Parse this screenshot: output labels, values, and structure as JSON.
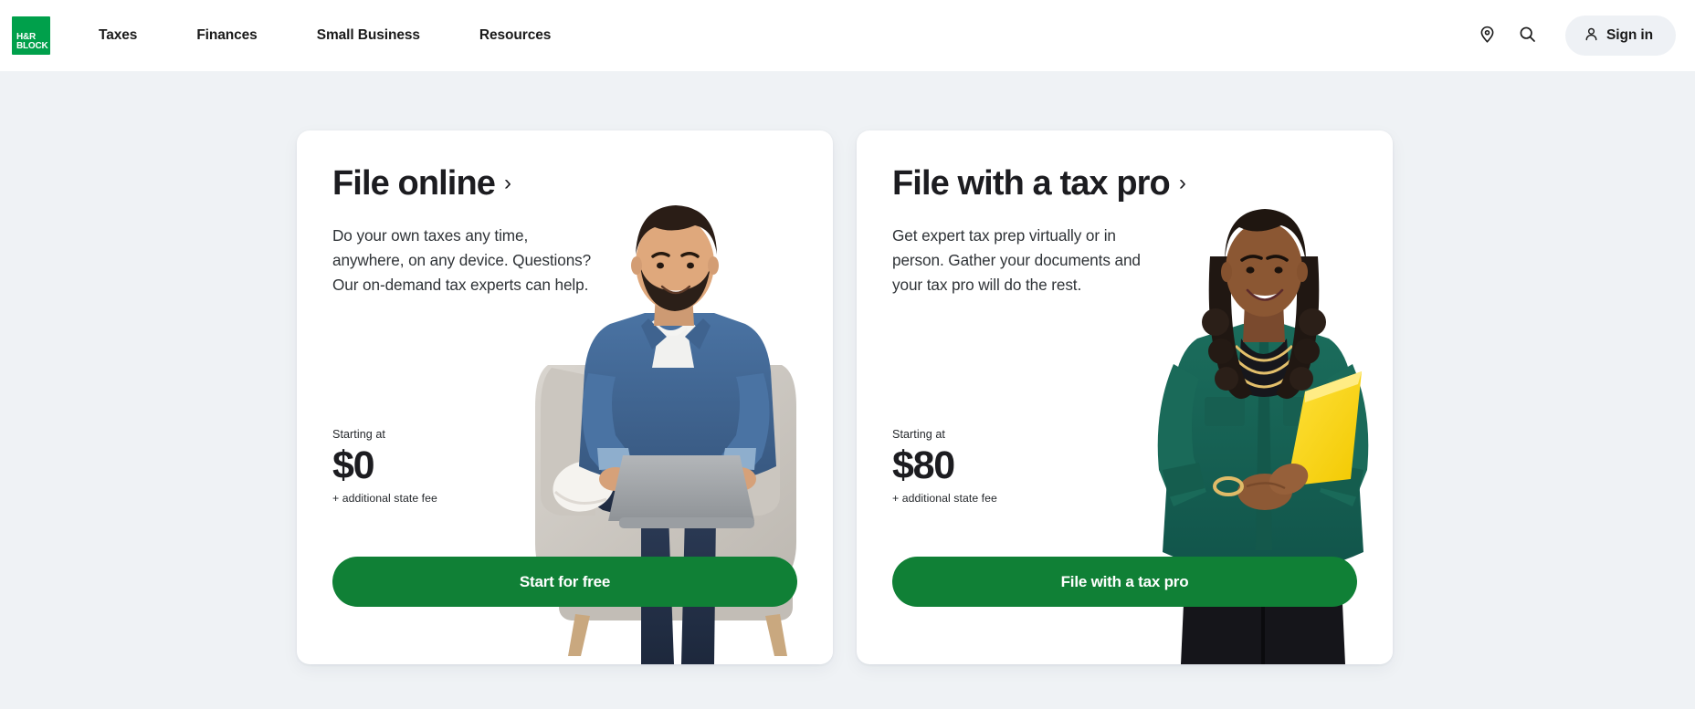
{
  "nav": {
    "logo": {
      "line1": "H&R",
      "line2": "BLOCK",
      "name": "H&R Block",
      "color": "#00a04b"
    },
    "links": [
      {
        "label": "Taxes",
        "name": "taxes"
      },
      {
        "label": "Finances",
        "name": "finances"
      },
      {
        "label": "Small Business",
        "name": "small-business"
      },
      {
        "label": "Resources",
        "name": "resources"
      }
    ],
    "location_icon": "location-pin-icon",
    "search_icon": "search-icon",
    "signin": {
      "label": "Sign in",
      "icon": "user-icon",
      "background": "#eef1f5"
    }
  },
  "page": {
    "background": "#eff2f5"
  },
  "cards": [
    {
      "id": "file-online",
      "heading": "File online",
      "chevron": "›",
      "description": "Do your own taxes any time, anywhere, on any device. Questions? Our on-demand tax experts can help.",
      "price_label": "Starting at",
      "price_amount": "$0",
      "price_note": "+ additional state fee",
      "cta_label": "Start for free",
      "cta_color": "#108036",
      "image_alt": "Smiling bearded man in a denim shirt sitting in a gray armchair using a laptop"
    },
    {
      "id": "file-with-a-tax-pro",
      "heading": "File with a tax pro",
      "chevron": "›",
      "description": "Get expert tax prep virtually or in person. Gather your documents and your tax pro will do the rest.",
      "price_label": "Starting at",
      "price_amount": "$80",
      "price_note": "+ additional state fee",
      "cta_label": "File with a tax pro",
      "cta_color": "#108036",
      "image_alt": "Smiling woman in a green blouse holding a yellow folder"
    }
  ]
}
